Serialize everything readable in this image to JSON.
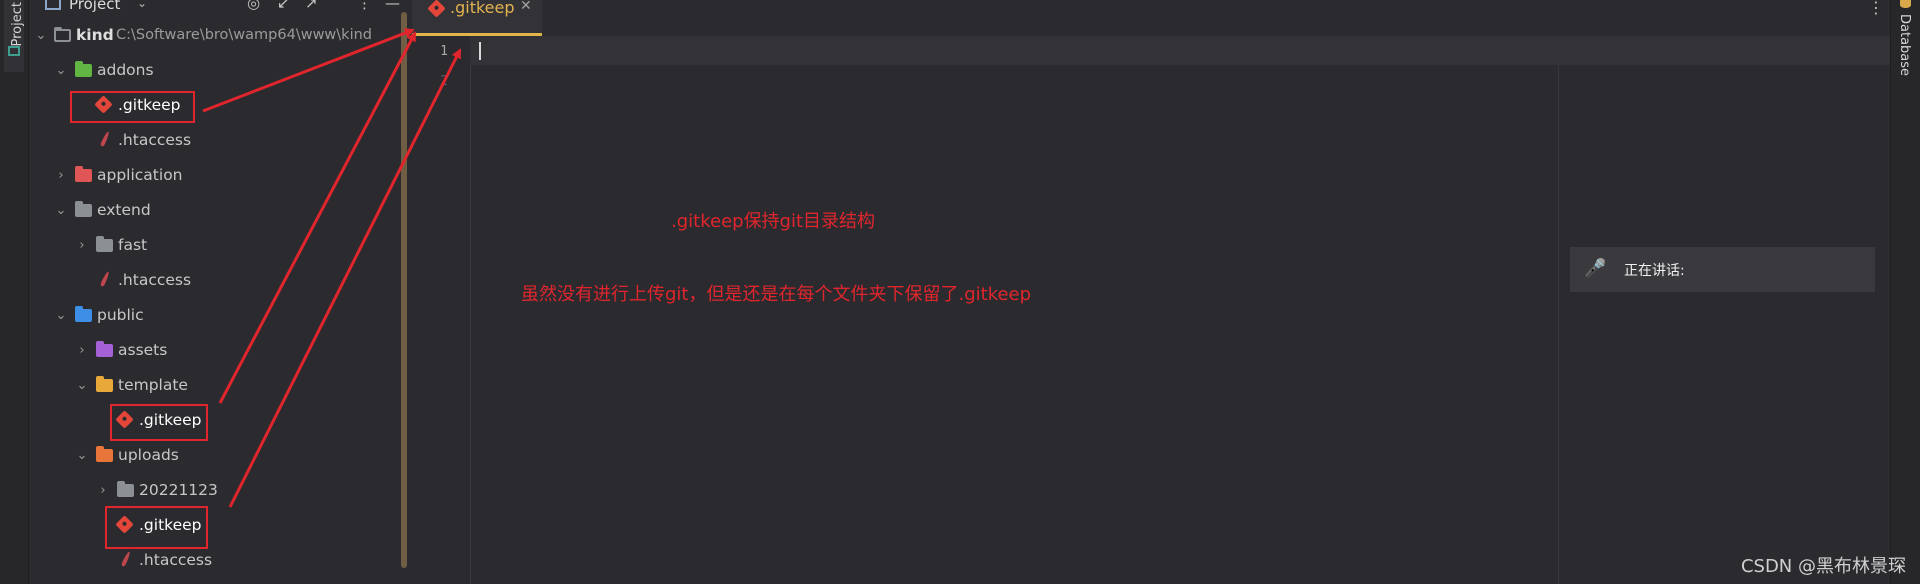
{
  "left_stripe": {
    "tab_label": "Project"
  },
  "project_panel": {
    "title": "Project",
    "tree": {
      "root": {
        "label": "kind",
        "path": "C:\\Software\\bro\\wamp64\\www\\kind"
      },
      "addons": "addons",
      "addons_gitkeep": ".gitkeep",
      "addons_htaccess": ".htaccess",
      "application": "application",
      "extend": "extend",
      "fast": "fast",
      "extend_htaccess": ".htaccess",
      "public": "public",
      "assets": "assets",
      "template": "template",
      "template_gitkeep": ".gitkeep",
      "uploads": "uploads",
      "date_folder": "20221123",
      "uploads_gitkeep": ".gitkeep",
      "uploads_htaccess": ".htaccess"
    }
  },
  "editor": {
    "tab": {
      "label": ".gitkeep"
    },
    "line_numbers": [
      "1",
      "2"
    ]
  },
  "annotations": {
    "line1": ".gitkeep保持git目录结构",
    "line2": "虽然没有进行上传git，但是还是在每个文件夹下保留了.gitkeep"
  },
  "speaking_overlay": {
    "text": "正在讲话:"
  },
  "right_stripe": {
    "tab_label": "Database"
  },
  "watermark": "CSDN @黑布林景琛",
  "colors": {
    "annotation_red": "#e0252d",
    "tab_accent": "#e0b54a"
  }
}
